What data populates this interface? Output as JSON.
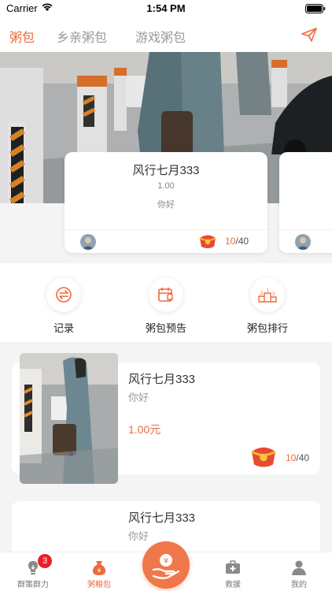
{
  "status_bar": {
    "carrier": "Carrier",
    "time": "1:54 PM"
  },
  "nav": {
    "tabs": [
      "粥包",
      "乡亲粥包",
      "游戏粥包"
    ],
    "active_tab": "粥包"
  },
  "featured_card": {
    "name": "风行七月333",
    "amount": "1.00",
    "message": "你好",
    "count_current": "10",
    "count_total": "/40"
  },
  "features": [
    {
      "label": "记录",
      "icon": "exchange-icon"
    },
    {
      "label": "粥包预告",
      "icon": "calendar-bell-icon"
    },
    {
      "label": "粥包排行",
      "icon": "podium-icon"
    }
  ],
  "list_items": [
    {
      "name": "风行七月333",
      "message": "你好",
      "price": "1.00元",
      "count_current": "10",
      "count_total": "/40"
    },
    {
      "name": "风行七月333",
      "message": "你好"
    }
  ],
  "tabbar": {
    "items": [
      {
        "label": "群策群力",
        "icon": "lightbulb-icon",
        "badge": "3"
      },
      {
        "label": "粥粮包",
        "icon": "money-bag-icon"
      },
      {
        "label": "救援",
        "icon": "medical-kit-icon"
      },
      {
        "label": "我的",
        "icon": "person-icon"
      }
    ],
    "active": "粥粮包"
  },
  "colors": {
    "accent": "#ee6b3d",
    "badge": "#e8202c",
    "background": "#f4f4f4"
  }
}
